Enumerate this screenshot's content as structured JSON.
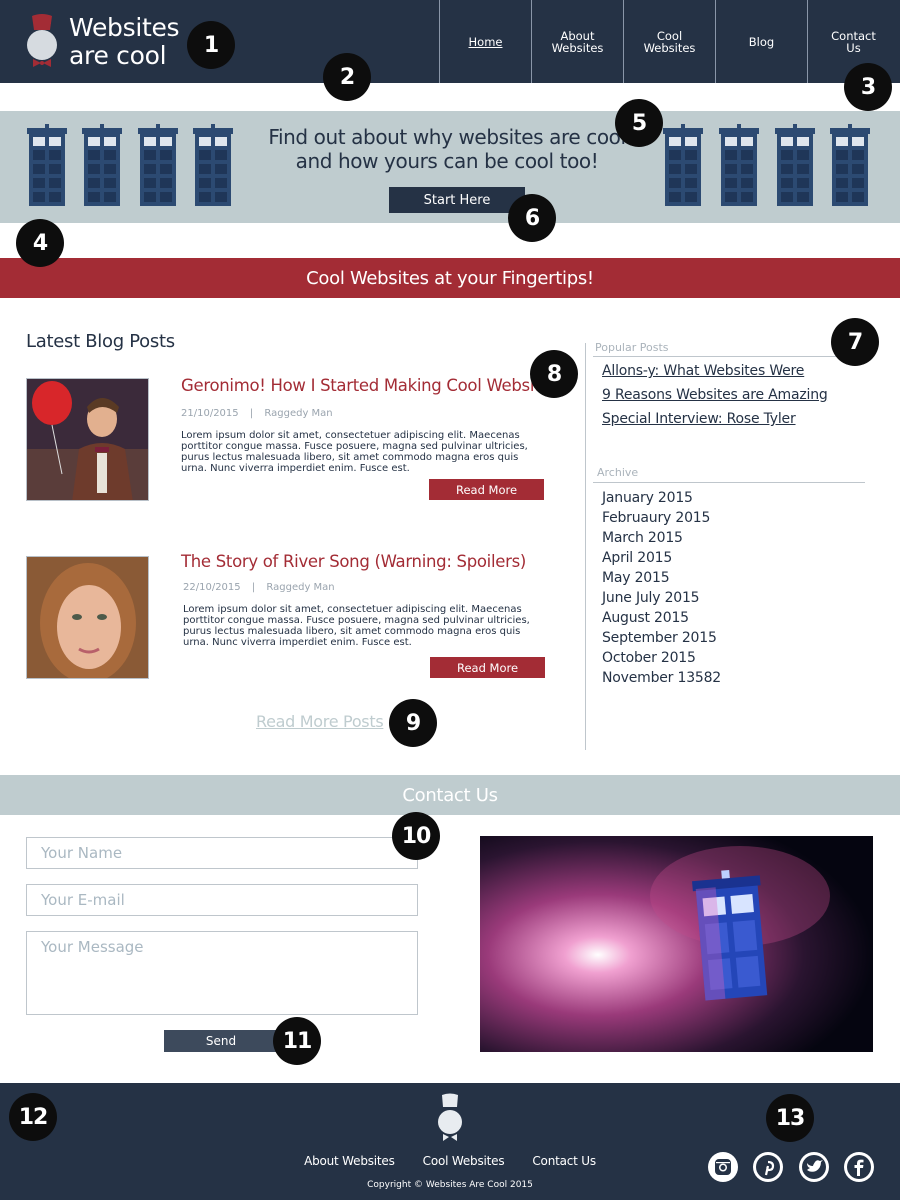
{
  "header": {
    "logo_line1": "Websites",
    "logo_line2": "are cool",
    "nav": [
      {
        "label": "Home"
      },
      {
        "label": "About\nWebsites"
      },
      {
        "label": "Cool\nWebsites"
      },
      {
        "label": "Blog"
      },
      {
        "label": "Contact\nUs"
      }
    ]
  },
  "hero": {
    "line1": "Find out about why websites are cool",
    "line2": "and how yours can be cool too!",
    "button": "Start Here"
  },
  "banner": "Cool Websites at your Fingertips!",
  "blog": {
    "heading": "Latest Blog Posts",
    "posts": [
      {
        "title": "Geronimo! How I Started Making Cool Websites",
        "date": "21/10/2015",
        "author": "Raggedy Man",
        "body": "Lorem ipsum dolor sit amet, consectetuer adipiscing elit. Maecenas porttitor congue massa. Fusce posuere, magna sed pulvinar ultricies, purus lectus malesuada libero, sit amet commodo magna eros quis urna. Nunc viverra imperdiet enim. Fusce est.",
        "button": "Read More"
      },
      {
        "title": "The Story of River Song (Warning: Spoilers)",
        "date": "22/10/2015",
        "author": "Raggedy Man",
        "body": "Lorem ipsum dolor sit amet, consectetuer adipiscing elit. Maecenas porttitor congue massa. Fusce posuere, magna sed pulvinar ultricies, purus lectus malesuada libero, sit amet commodo magna eros quis urna. Nunc viverra imperdiet enim. Fusce est.",
        "button": "Read More"
      }
    ],
    "more_link": "Read More Posts",
    "separator": "|"
  },
  "sidebar": {
    "popular_heading": "Popular Posts",
    "popular": [
      "Allons-y: What Websites Were",
      "9 Reasons Websites are Amazing",
      "Special Interview: Rose Tyler"
    ],
    "archive_heading": "Archive",
    "archive": [
      "January 2015",
      "Februaury 2015",
      "March 2015",
      "April 2015",
      "May 2015",
      "June July 2015",
      "August 2015",
      "September 2015",
      "October 2015",
      "November 13582"
    ]
  },
  "contact": {
    "heading": "Contact Us",
    "name_placeholder": "Your Name",
    "email_placeholder": "Your E-mail",
    "message_placeholder": "Your Message",
    "send": "Send"
  },
  "footer": {
    "links": [
      "About Websites",
      "Cool Websites",
      "Contact Us"
    ],
    "copyright": "Copyright © Websites Are Cool 2015",
    "social_icons": [
      "instagram-icon",
      "pinterest-icon",
      "twitter-icon",
      "facebook-icon"
    ]
  },
  "markers": [
    "1",
    "2",
    "3",
    "4",
    "5",
    "6",
    "7",
    "8",
    "9",
    "10",
    "11",
    "12",
    "13"
  ],
  "colors": {
    "navy": "#253245",
    "red": "#a32c35",
    "pale_blue": "#bfcccf",
    "tardis_blue": "#2c4a72"
  }
}
